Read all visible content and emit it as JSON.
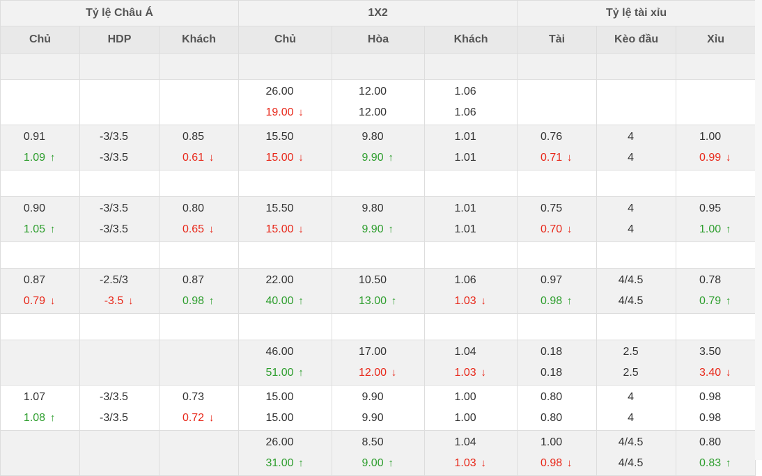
{
  "groups": [
    {
      "label": "Tỷ lệ Châu Á",
      "span": 3
    },
    {
      "label": "1X2",
      "span": 3
    },
    {
      "label": "Tỷ lệ tài xỉu",
      "span": 3
    }
  ],
  "columns": [
    "Chủ",
    "HDP",
    "Khách",
    "Chủ",
    "Hòa",
    "Khách",
    "Tài",
    "Kèo đầu",
    "Xỉu"
  ],
  "colors": {
    "up": "#2e9e2e",
    "down": "#e8281a",
    "neutral": "#333333"
  },
  "rows": [
    {
      "kind": "spacer",
      "bg": "gray"
    },
    {
      "kind": "data",
      "bg": "white",
      "cells": [
        [],
        [],
        [],
        [
          {
            "v": "26.00"
          },
          {
            "v": "19.00",
            "d": "down"
          }
        ],
        [
          {
            "v": "12.00"
          },
          {
            "v": "12.00"
          }
        ],
        [
          {
            "v": "1.06"
          },
          {
            "v": "1.06"
          }
        ],
        [],
        [],
        []
      ]
    },
    {
      "kind": "data",
      "bg": "gray",
      "cells": [
        [
          {
            "v": "0.91"
          },
          {
            "v": "1.09",
            "d": "up"
          }
        ],
        [
          {
            "v": "-3/3.5"
          },
          {
            "v": "-3/3.5"
          }
        ],
        [
          {
            "v": "0.85"
          },
          {
            "v": "0.61",
            "d": "down"
          }
        ],
        [
          {
            "v": "15.50"
          },
          {
            "v": "15.00",
            "d": "down"
          }
        ],
        [
          {
            "v": "9.80"
          },
          {
            "v": "9.90",
            "d": "up"
          }
        ],
        [
          {
            "v": "1.01"
          },
          {
            "v": "1.01"
          }
        ],
        [
          {
            "v": "0.76"
          },
          {
            "v": "0.71",
            "d": "down"
          }
        ],
        [
          {
            "v": "4"
          },
          {
            "v": "4"
          }
        ],
        [
          {
            "v": "1.00"
          },
          {
            "v": "0.99",
            "d": "down"
          }
        ]
      ]
    },
    {
      "kind": "spacer",
      "bg": "white"
    },
    {
      "kind": "data",
      "bg": "gray",
      "cells": [
        [
          {
            "v": "0.90"
          },
          {
            "v": "1.05",
            "d": "up"
          }
        ],
        [
          {
            "v": "-3/3.5"
          },
          {
            "v": "-3/3.5"
          }
        ],
        [
          {
            "v": "0.80"
          },
          {
            "v": "0.65",
            "d": "down"
          }
        ],
        [
          {
            "v": "15.50"
          },
          {
            "v": "15.00",
            "d": "down"
          }
        ],
        [
          {
            "v": "9.80"
          },
          {
            "v": "9.90",
            "d": "up"
          }
        ],
        [
          {
            "v": "1.01"
          },
          {
            "v": "1.01"
          }
        ],
        [
          {
            "v": "0.75"
          },
          {
            "v": "0.70",
            "d": "down"
          }
        ],
        [
          {
            "v": "4"
          },
          {
            "v": "4"
          }
        ],
        [
          {
            "v": "0.95"
          },
          {
            "v": "1.00",
            "d": "up"
          }
        ]
      ]
    },
    {
      "kind": "spacer",
      "bg": "white"
    },
    {
      "kind": "data",
      "bg": "gray",
      "cells": [
        [
          {
            "v": "0.87"
          },
          {
            "v": "0.79",
            "d": "down"
          }
        ],
        [
          {
            "v": "-2.5/3"
          },
          {
            "v": "-3.5",
            "d": "down"
          }
        ],
        [
          {
            "v": "0.87"
          },
          {
            "v": "0.98",
            "d": "up"
          }
        ],
        [
          {
            "v": "22.00"
          },
          {
            "v": "40.00",
            "d": "up"
          }
        ],
        [
          {
            "v": "10.50"
          },
          {
            "v": "13.00",
            "d": "up"
          }
        ],
        [
          {
            "v": "1.06"
          },
          {
            "v": "1.03",
            "d": "down"
          }
        ],
        [
          {
            "v": "0.97"
          },
          {
            "v": "0.98",
            "d": "up"
          }
        ],
        [
          {
            "v": "4/4.5"
          },
          {
            "v": "4/4.5"
          }
        ],
        [
          {
            "v": "0.78"
          },
          {
            "v": "0.79",
            "d": "up"
          }
        ]
      ]
    },
    {
      "kind": "spacer",
      "bg": "white"
    },
    {
      "kind": "data",
      "bg": "gray",
      "cells": [
        [],
        [],
        [],
        [
          {
            "v": "46.00"
          },
          {
            "v": "51.00",
            "d": "up"
          }
        ],
        [
          {
            "v": "17.00"
          },
          {
            "v": "12.00",
            "d": "down"
          }
        ],
        [
          {
            "v": "1.04"
          },
          {
            "v": "1.03",
            "d": "down"
          }
        ],
        [
          {
            "v": "0.18"
          },
          {
            "v": "0.18"
          }
        ],
        [
          {
            "v": "2.5"
          },
          {
            "v": "2.5"
          }
        ],
        [
          {
            "v": "3.50"
          },
          {
            "v": "3.40",
            "d": "down"
          }
        ]
      ]
    },
    {
      "kind": "data",
      "bg": "white",
      "cells": [
        [
          {
            "v": "1.07"
          },
          {
            "v": "1.08",
            "d": "up"
          }
        ],
        [
          {
            "v": "-3/3.5"
          },
          {
            "v": "-3/3.5"
          }
        ],
        [
          {
            "v": "0.73"
          },
          {
            "v": "0.72",
            "d": "down"
          }
        ],
        [
          {
            "v": "15.00"
          },
          {
            "v": "15.00"
          }
        ],
        [
          {
            "v": "9.90"
          },
          {
            "v": "9.90"
          }
        ],
        [
          {
            "v": "1.00"
          },
          {
            "v": "1.00"
          }
        ],
        [
          {
            "v": "0.80"
          },
          {
            "v": "0.80"
          }
        ],
        [
          {
            "v": "4"
          },
          {
            "v": "4"
          }
        ],
        [
          {
            "v": "0.98"
          },
          {
            "v": "0.98"
          }
        ]
      ]
    },
    {
      "kind": "data",
      "bg": "gray",
      "cells": [
        [],
        [],
        [],
        [
          {
            "v": "26.00"
          },
          {
            "v": "31.00",
            "d": "up"
          }
        ],
        [
          {
            "v": "8.50"
          },
          {
            "v": "9.00",
            "d": "up"
          }
        ],
        [
          {
            "v": "1.04"
          },
          {
            "v": "1.03",
            "d": "down"
          }
        ],
        [
          {
            "v": "1.00"
          },
          {
            "v": "0.98",
            "d": "down"
          }
        ],
        [
          {
            "v": "4/4.5"
          },
          {
            "v": "4/4.5"
          }
        ],
        [
          {
            "v": "0.80"
          },
          {
            "v": "0.83",
            "d": "up"
          }
        ]
      ]
    }
  ]
}
